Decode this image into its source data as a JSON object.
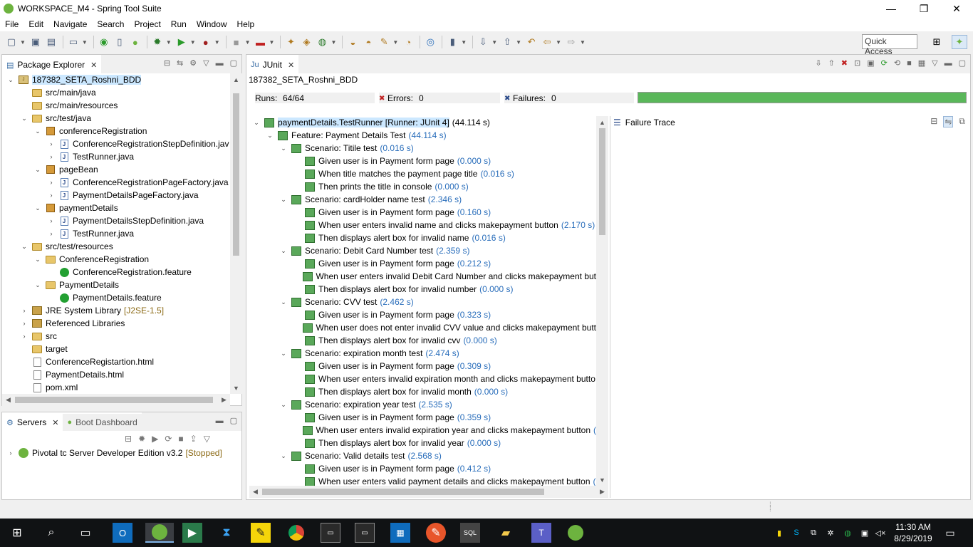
{
  "window": {
    "title": "WORKSPACE_M4 - Spring Tool Suite",
    "minimize": "—",
    "restore": "❐",
    "close": "✕"
  },
  "menubar": [
    "File",
    "Edit",
    "Navigate",
    "Search",
    "Project",
    "Run",
    "Window",
    "Help"
  ],
  "toolbar": {
    "quick_access_label": "Quick Access",
    "icons": [
      "new-icon",
      "save-icon",
      "save-all-icon",
      "console-icon",
      "skip-breakpoints-icon",
      "stop-icon",
      "toggle-mark-icon",
      "spring-icon",
      "debug-icon",
      "run-icon",
      "run-external-icon",
      "terminate-icon",
      "build-icon",
      "new-java-project-icon",
      "new-package-icon",
      "new-class-icon",
      "open-type-icon",
      "open-task-icon",
      "search-icon",
      "globe-icon",
      "annotation-icon",
      "next-annotation-icon",
      "prev-annotation-icon",
      "last-edit-icon",
      "back-icon",
      "forward-icon"
    ]
  },
  "package_explorer": {
    "tab_label": "Package Explorer",
    "tree": [
      {
        "label": "187382_SETA_Roshni_BDD",
        "depth": 0,
        "toggle": "expanded",
        "icon": "project",
        "selected": true
      },
      {
        "label": "src/main/java",
        "depth": 1,
        "toggle": "none",
        "icon": "folder"
      },
      {
        "label": "src/main/resources",
        "depth": 1,
        "toggle": "none",
        "icon": "folder"
      },
      {
        "label": "src/test/java",
        "depth": 1,
        "toggle": "expanded",
        "icon": "folder"
      },
      {
        "label": "conferenceRegistration",
        "depth": 2,
        "toggle": "expanded",
        "icon": "package"
      },
      {
        "label": "ConferenceRegistrationStepDefinition.jav",
        "depth": 3,
        "toggle": "collapsed",
        "icon": "java"
      },
      {
        "label": "TestRunner.java",
        "depth": 3,
        "toggle": "collapsed",
        "icon": "java"
      },
      {
        "label": "pageBean",
        "depth": 2,
        "toggle": "expanded",
        "icon": "package"
      },
      {
        "label": "ConferenceRegistrationPageFactory.java",
        "depth": 3,
        "toggle": "collapsed",
        "icon": "java"
      },
      {
        "label": "PaymentDetailsPageFactory.java",
        "depth": 3,
        "toggle": "collapsed",
        "icon": "java"
      },
      {
        "label": "paymentDetails",
        "depth": 2,
        "toggle": "expanded",
        "icon": "package"
      },
      {
        "label": "PaymentDetailsStepDefinition.java",
        "depth": 3,
        "toggle": "collapsed",
        "icon": "java"
      },
      {
        "label": "TestRunner.java",
        "depth": 3,
        "toggle": "collapsed",
        "icon": "java"
      },
      {
        "label": "src/test/resources",
        "depth": 1,
        "toggle": "expanded",
        "icon": "folder"
      },
      {
        "label": "ConferenceRegistration",
        "depth": 2,
        "toggle": "expanded",
        "icon": "folder"
      },
      {
        "label": "ConferenceRegistration.feature",
        "depth": 3,
        "toggle": "none",
        "icon": "cucumber"
      },
      {
        "label": "PaymentDetails",
        "depth": 2,
        "toggle": "expanded",
        "icon": "folder"
      },
      {
        "label": "PaymentDetails.feature",
        "depth": 3,
        "toggle": "none",
        "icon": "cucumber"
      },
      {
        "label": "JRE System Library",
        "decoration": "[J2SE-1.5]",
        "depth": 1,
        "toggle": "collapsed",
        "icon": "library"
      },
      {
        "label": "Referenced Libraries",
        "depth": 1,
        "toggle": "collapsed",
        "icon": "library"
      },
      {
        "label": "src",
        "depth": 1,
        "toggle": "collapsed",
        "icon": "folder"
      },
      {
        "label": "target",
        "depth": 1,
        "toggle": "none",
        "icon": "folder"
      },
      {
        "label": "ConferenceRegistartion.html",
        "depth": 1,
        "toggle": "none",
        "icon": "file"
      },
      {
        "label": "PaymentDetails.html",
        "depth": 1,
        "toggle": "none",
        "icon": "file"
      },
      {
        "label": "pom.xml",
        "depth": 1,
        "toggle": "none",
        "icon": "file"
      }
    ]
  },
  "servers": {
    "tab_label": "Servers",
    "boot_tab_label": "Boot Dashboard",
    "items": [
      {
        "label": "Pivotal tc Server Developer Edition v3.2",
        "status": "[Stopped]"
      }
    ]
  },
  "junit": {
    "tab_label": "JUnit",
    "project_name": "187382_SETA_Roshni_BDD",
    "runs_label": "Runs:",
    "runs_value": "64/64",
    "errors_label": "Errors:",
    "errors_value": "0",
    "failures_label": "Failures:",
    "failures_value": "0",
    "progress_fraction": 1.0,
    "progress_color": "#5ab75a",
    "failure_trace_label": "Failure Trace",
    "tree": [
      {
        "label": "paymentDetails.TestRunner [Runner: JUnit 4]",
        "duration": "(44.114 s)",
        "depth": 0,
        "toggle": "expanded",
        "selected": true,
        "duration_plain": true
      },
      {
        "label": "Feature: Payment Details Test",
        "duration": "(44.114 s)",
        "depth": 1,
        "toggle": "expanded"
      },
      {
        "label": "Scenario: Titile test",
        "duration": "(0.016 s)",
        "depth": 2,
        "toggle": "expanded"
      },
      {
        "label": "Given user is in Payment form page",
        "duration": "(0.000 s)",
        "depth": 3,
        "toggle": "none"
      },
      {
        "label": "When title matches the payment page title",
        "duration": "(0.016 s)",
        "depth": 3,
        "toggle": "none"
      },
      {
        "label": "Then prints the title in console",
        "duration": "(0.000 s)",
        "depth": 3,
        "toggle": "none"
      },
      {
        "label": "Scenario: cardHolder name test",
        "duration": "(2.346 s)",
        "depth": 2,
        "toggle": "expanded"
      },
      {
        "label": "Given user is in Payment form page",
        "duration": "(0.160 s)",
        "depth": 3,
        "toggle": "none"
      },
      {
        "label": "When user enters invalid name  and clicks makepayment button",
        "duration": "(2.170 s)",
        "depth": 3,
        "toggle": "none"
      },
      {
        "label": "Then displays alert box for invalid name",
        "duration": "(0.016 s)",
        "depth": 3,
        "toggle": "none"
      },
      {
        "label": "Scenario: Debit Card Number test",
        "duration": "(2.359 s)",
        "depth": 2,
        "toggle": "expanded"
      },
      {
        "label": "Given user is in Payment form page",
        "duration": "(0.212 s)",
        "depth": 3,
        "toggle": "none"
      },
      {
        "label": "When user enters invalid Debit Card Number and clicks makepayment but",
        "duration": "",
        "depth": 3,
        "toggle": "none"
      },
      {
        "label": "Then displays alert box for invalid number",
        "duration": "(0.000 s)",
        "depth": 3,
        "toggle": "none"
      },
      {
        "label": "Scenario: CVV test",
        "duration": "(2.462 s)",
        "depth": 2,
        "toggle": "expanded"
      },
      {
        "label": "Given user is in Payment form page",
        "duration": "(0.323 s)",
        "depth": 3,
        "toggle": "none"
      },
      {
        "label": "When user does not enter invalid CVV value and clicks makepayment butt",
        "duration": "",
        "depth": 3,
        "toggle": "none"
      },
      {
        "label": "Then displays alert box for invalid cvv",
        "duration": "(0.000 s)",
        "depth": 3,
        "toggle": "none"
      },
      {
        "label": "Scenario: expiration month test",
        "duration": "(2.474 s)",
        "depth": 2,
        "toggle": "expanded"
      },
      {
        "label": "Given user is in Payment form page",
        "duration": "(0.309 s)",
        "depth": 3,
        "toggle": "none"
      },
      {
        "label": "When user enters invalid expiration month and clicks makepayment butto",
        "duration": "",
        "depth": 3,
        "toggle": "none"
      },
      {
        "label": "Then displays alert box for invalid month",
        "duration": "(0.000 s)",
        "depth": 3,
        "toggle": "none"
      },
      {
        "label": "Scenario: expiration year test",
        "duration": "(2.535 s)",
        "depth": 2,
        "toggle": "expanded"
      },
      {
        "label": "Given user is in Payment form page",
        "duration": "(0.359 s)",
        "depth": 3,
        "toggle": "none"
      },
      {
        "label": "When user enters invalid expiration year and clicks makepayment button",
        "duration": "(",
        "depth": 3,
        "toggle": "none"
      },
      {
        "label": "Then displays alert box for invalid year",
        "duration": "(0.000 s)",
        "depth": 3,
        "toggle": "none"
      },
      {
        "label": "Scenario: Valid details test",
        "duration": "(2.568 s)",
        "depth": 2,
        "toggle": "expanded"
      },
      {
        "label": "Given user is in Payment form page",
        "duration": "(0.412 s)",
        "depth": 3,
        "toggle": "none"
      },
      {
        "label": "When user enters valid  payment details and clicks makepayment button",
        "duration": "(",
        "depth": 3,
        "toggle": "none"
      }
    ]
  },
  "taskbar": {
    "time": "11:30 AM",
    "date": "8/29/2019",
    "apps": [
      "start-icon",
      "search-icon",
      "task-view-icon",
      "outlook-icon",
      "spring-tool-suite-icon",
      "media-icon",
      "vscode-icon",
      "sticky-notes-icon",
      "chrome-icon",
      "cmd-icon",
      "cmd-icon-2",
      "outlook-calendar-icon",
      "git-icon",
      "sql-icon",
      "file-explorer-icon",
      "teams-icon",
      "spring-icon-2"
    ]
  }
}
